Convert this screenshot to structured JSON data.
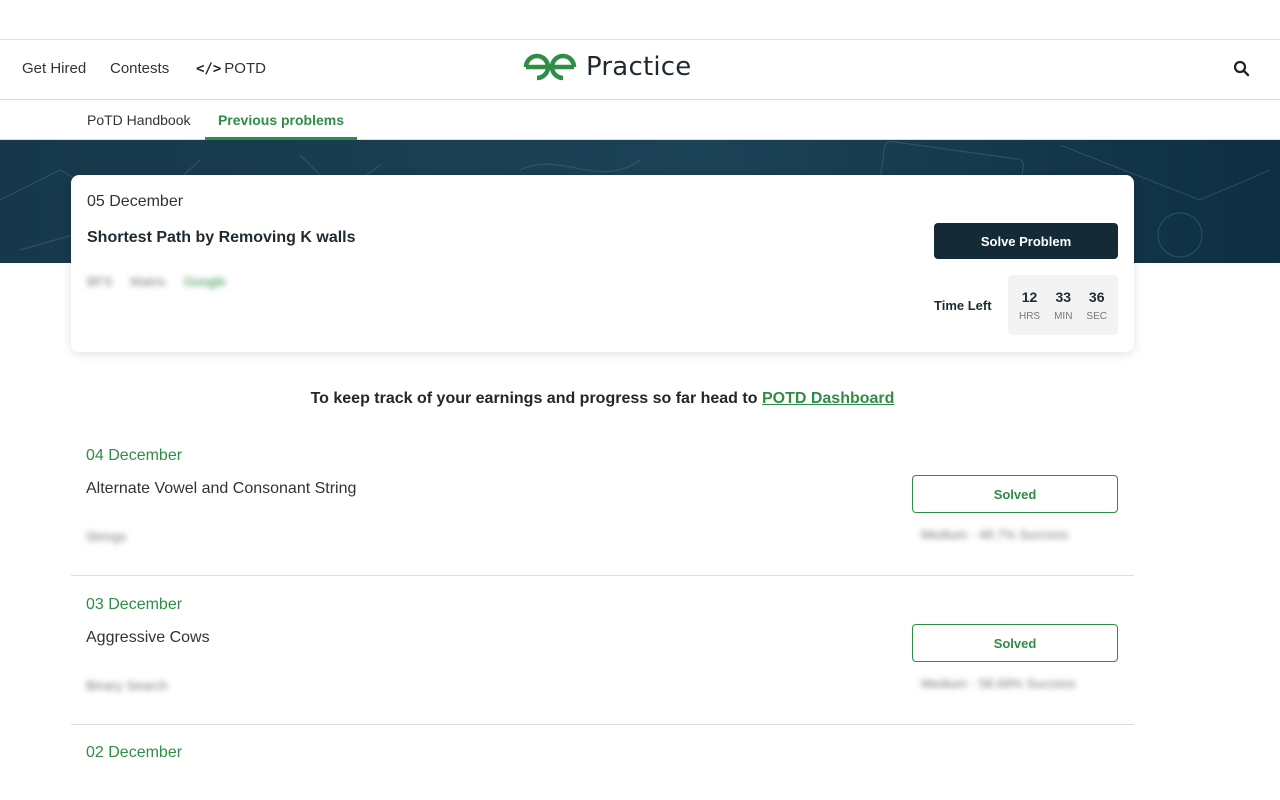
{
  "nav": {
    "get_hired": "Get Hired",
    "contests": "Contests",
    "potd": "POTD",
    "brand": "Practice"
  },
  "icons": {
    "brand": "gfg-logo-icon",
    "potd": "code-icon",
    "search": "search-icon"
  },
  "subnav": {
    "handbook": "PoTD Handbook",
    "previous": "Previous problems"
  },
  "featured": {
    "date": "05 December",
    "title": "Shortest Path by Removing K walls",
    "tags": [
      "BFS",
      "Matrix",
      "Google"
    ],
    "solve_label": "Solve Problem",
    "time_left_label": "Time Left",
    "timer": {
      "hours": "12",
      "hours_label": "HRS",
      "minutes": "33",
      "minutes_label": "MIN",
      "seconds": "36",
      "seconds_label": "SEC"
    }
  },
  "track": {
    "message": "To keep track of your earnings and progress so far head to ",
    "link": "POTD Dashboard"
  },
  "problems": [
    {
      "date": "04 December",
      "title": "Alternate Vowel and Consonant String",
      "tag": "Strings",
      "meta": "Medium · 48.7% Success",
      "status": "Solved"
    },
    {
      "date": "03 December",
      "title": "Aggressive Cows",
      "tag": "Binary Search",
      "meta": "Medium · 58.69% Success",
      "status": "Solved"
    },
    {
      "date": "02 December"
    }
  ],
  "colors": {
    "accent": "#2f8d46",
    "banner": "#16384a",
    "button": "#142a36"
  }
}
